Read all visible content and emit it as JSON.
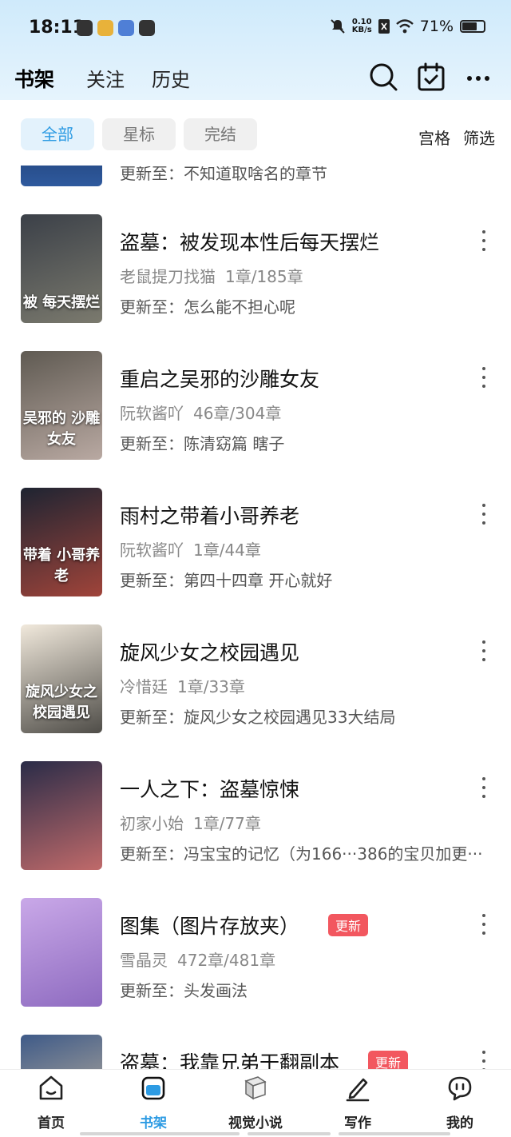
{
  "status_bar": {
    "time": "18:11",
    "net_speed_value": "0.10",
    "net_speed_unit": "KB/s",
    "battery": "71%",
    "battery_level": 0.71
  },
  "header": {
    "tabs": [
      "书架",
      "关注",
      "历史"
    ],
    "active_tab": 0,
    "icons": [
      "search-icon",
      "calendar-check-icon",
      "more-icon"
    ]
  },
  "filters": {
    "chips": [
      "全部",
      "星标",
      "完结"
    ],
    "active": 0,
    "options": [
      "宫格",
      "筛选"
    ]
  },
  "partial_item": {
    "update": "更新至：不知道取啥名的章节"
  },
  "books": [
    {
      "title": "盗墓：被发现本性后每天摆烂",
      "author": "老鼠提刀找猫",
      "progress": "1章/185章",
      "update": "更新至：怎么能不担心呢",
      "cover_text": "被 每天摆烂",
      "cover_colors": [
        "#3b4048",
        "#7b7a6e"
      ],
      "badge": ""
    },
    {
      "title": "重启之吴邪的沙雕女友",
      "author": "阮软酱吖",
      "progress": "46章/304章",
      "update": "更新至：陈清窈篇 瞎子",
      "cover_text": "吴邪的 沙雕女友",
      "cover_colors": [
        "#5f5a52",
        "#b9a9a2"
      ],
      "badge": ""
    },
    {
      "title": "雨村之带着小哥养老",
      "author": "阮软酱吖",
      "progress": "1章/44章",
      "update": "更新至：第四十四章 开心就好",
      "cover_text": "带着 小哥养老",
      "cover_colors": [
        "#1e2432",
        "#a0443a"
      ],
      "badge": ""
    },
    {
      "title": "旋风少女之校园遇见",
      "author": "冷惜廷",
      "progress": "1章/33章",
      "update": "更新至：旋风少女之校园遇见33大结局",
      "cover_text": "旋风少女之 校园遇见",
      "cover_colors": [
        "#f1e9dc",
        "#4f4d48"
      ],
      "badge": ""
    },
    {
      "title": "一人之下：盗墓惊悚",
      "author": "初家小始",
      "progress": "1章/77章",
      "update": "更新至：冯宝宝的记忆（为166···386的宝贝加更···",
      "cover_text": "",
      "cover_colors": [
        "#2a2c48",
        "#c06a6a"
      ],
      "badge": ""
    },
    {
      "title": "图集（图片存放夹）",
      "author": "雪晶灵",
      "progress": "472章/481章",
      "update": "更新至：头发画法",
      "cover_text": "",
      "cover_colors": [
        "#c9a8e8",
        "#8e6bc0"
      ],
      "badge": "更新"
    },
    {
      "title": "盗墓：我靠兄弟干翻副本",
      "author": "",
      "progress": "",
      "update": "",
      "cover_text": "",
      "cover_colors": [
        "#3e5a88",
        "#d6c2a2"
      ],
      "badge": "更新"
    }
  ],
  "bottom_nav": {
    "items": [
      {
        "label": "首页",
        "icon": "home-icon"
      },
      {
        "label": "书架",
        "icon": "bookshelf-icon"
      },
      {
        "label": "视觉小说",
        "icon": "book-icon"
      },
      {
        "label": "写作",
        "icon": "pen-icon"
      },
      {
        "label": "我的",
        "icon": "chat-profile-icon"
      }
    ],
    "active": 1
  },
  "colors": {
    "accent": "#2d9be3",
    "badge": "#f2575f",
    "header_bg": "#d9effc"
  }
}
